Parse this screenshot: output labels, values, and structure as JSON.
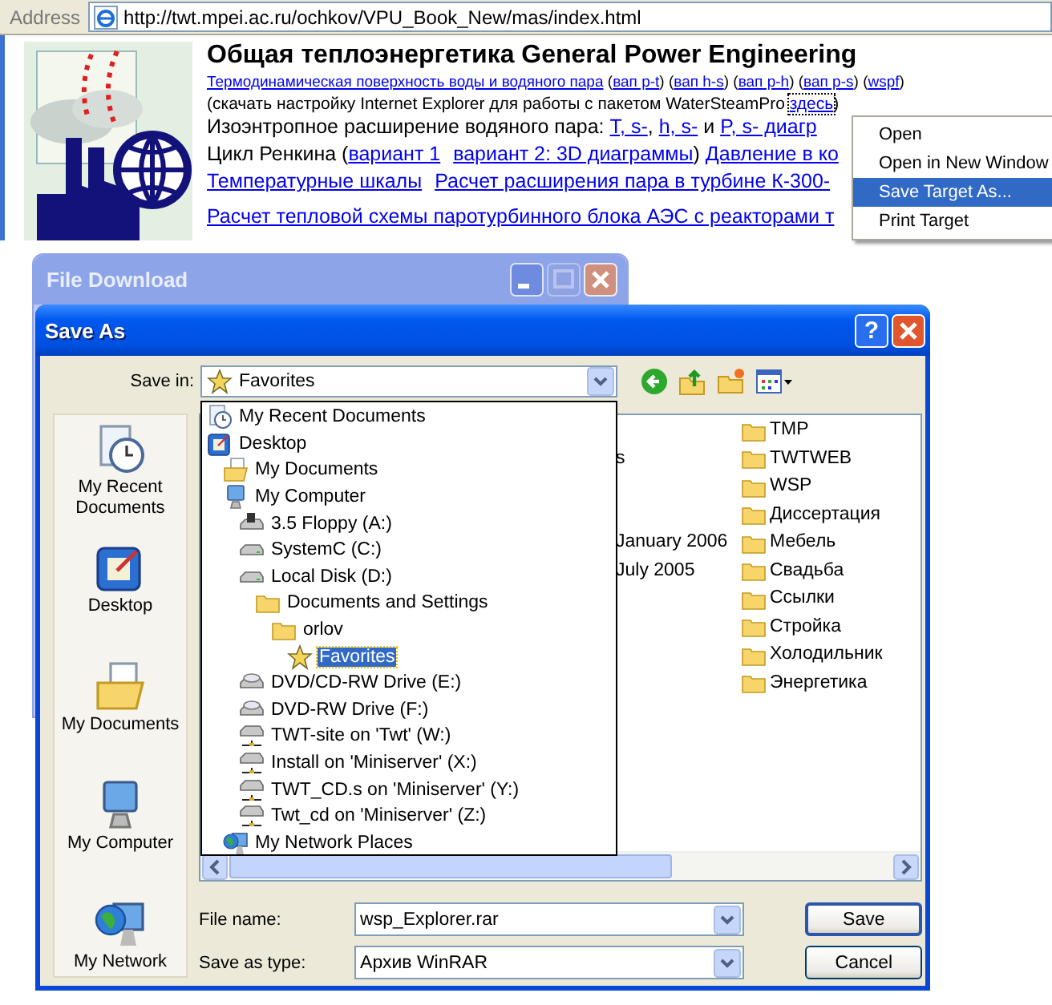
{
  "address_bar": {
    "label": "Address",
    "url": "http://twt.mpei.ac.ru/ochkov/VPU_Book_New/mas/index.html"
  },
  "page": {
    "title": "Общая теплоэнергетика General Power Engineering",
    "lines": [
      [
        {
          "text": "Термодинамическая поверхность воды и водяного пара",
          "kind": "link"
        },
        {
          "text": " (",
          "kind": "text"
        },
        {
          "text": "вап p-t",
          "kind": "link"
        },
        {
          "text": ") (",
          "kind": "text"
        },
        {
          "text": "вап h-s",
          "kind": "link"
        },
        {
          "text": ") (",
          "kind": "text"
        },
        {
          "text": "вап p-h",
          "kind": "link"
        },
        {
          "text": ") (",
          "kind": "text"
        },
        {
          "text": "вап p-s",
          "kind": "link"
        },
        {
          "text": ") (",
          "kind": "text"
        },
        {
          "text": "wspf",
          "kind": "link"
        },
        {
          "text": ")",
          "kind": "text"
        }
      ],
      [
        {
          "text": "(скачать настройку Internet Explorer для работы с пакетом WaterSteamPro ",
          "kind": "text"
        },
        {
          "text": "здесь",
          "kind": "link",
          "focused": true
        },
        {
          "text": ")",
          "kind": "text"
        }
      ],
      [
        {
          "text": "Изоэнтропное расширение водяного пара: ",
          "kind": "text"
        },
        {
          "text": "T, s-",
          "kind": "link"
        },
        {
          "text": ", ",
          "kind": "text"
        },
        {
          "text": "h, s-",
          "kind": "link"
        },
        {
          "text": " и ",
          "kind": "text"
        },
        {
          "text": "P, s- диагр",
          "kind": "link"
        }
      ],
      [
        {
          "text": "Цикл Ренкина (",
          "kind": "text"
        },
        {
          "text": "вариант 1",
          "kind": "link"
        },
        {
          "text": "вариант 2: 3D диаграммы",
          "kind": "link"
        },
        {
          "text": ") ",
          "kind": "text"
        },
        {
          "text": "Давление в ко",
          "kind": "link"
        }
      ],
      [
        {
          "text": "Температурные шкалы",
          "kind": "link"
        },
        {
          "text": "Расчет расширения пара в турбине К-300-",
          "kind": "link"
        }
      ],
      [
        {
          "text": "Расчет тепловой схемы паротурбинного блока АЭС с реакторами т",
          "kind": "link"
        }
      ]
    ]
  },
  "context_menu": {
    "items": [
      {
        "label": "Open",
        "selected": false
      },
      {
        "label": "Open in New Window",
        "selected": false
      },
      {
        "label": "Save Target As...",
        "selected": true
      },
      {
        "label": "Print Target",
        "selected": false
      }
    ]
  },
  "file_download": {
    "title": "File Download"
  },
  "save_as": {
    "title": "Save As",
    "help": "?",
    "save_in": {
      "label": "Save in:",
      "value": "Favorites",
      "kind": "favorites"
    },
    "places": [
      {
        "label": "My Recent Documents",
        "kind": "recent"
      },
      {
        "label": "Desktop",
        "kind": "desktop"
      },
      {
        "label": "My Documents",
        "kind": "documents"
      },
      {
        "label": "My Computer",
        "kind": "computer"
      },
      {
        "label": "My Network",
        "kind": "network"
      }
    ],
    "dropdown": [
      {
        "label": "My Recent Documents",
        "kind": "recent",
        "selected": false
      },
      {
        "label": "Desktop",
        "kind": "desktop",
        "selected": false,
        "children": [
          {
            "label": "My Documents",
            "kind": "documents",
            "selected": false
          },
          {
            "label": "My Computer",
            "kind": "computer",
            "selected": false,
            "children": [
              {
                "label": "3.5 Floppy (A:)",
                "kind": "floppy",
                "selected": false
              },
              {
                "label": "SystemC (C:)",
                "kind": "drive",
                "selected": false
              },
              {
                "label": "Local Disk (D:)",
                "kind": "drive",
                "selected": false,
                "children": [
                  {
                    "label": "Documents and Settings",
                    "kind": "folder",
                    "selected": false,
                    "children": [
                      {
                        "label": "orlov",
                        "kind": "folder",
                        "selected": false,
                        "children": [
                          {
                            "label": "Favorites",
                            "kind": "favorites",
                            "selected": true
                          }
                        ]
                      }
                    ]
                  }
                ]
              },
              {
                "label": "DVD/CD-RW Drive (E:)",
                "kind": "cd",
                "selected": false
              },
              {
                "label": "DVD-RW Drive (F:)",
                "kind": "cd",
                "selected": false
              },
              {
                "label": "TWT-site on 'Twt' (W:)",
                "kind": "netdrive",
                "selected": false
              },
              {
                "label": "Install on 'Miniserver' (X:)",
                "kind": "netdrive",
                "selected": false
              },
              {
                "label": "TWT_CD.s on 'Miniserver' (Y:)",
                "kind": "netdrive",
                "selected": false
              },
              {
                "label": "Twt_cd on 'Miniserver' (Z:)",
                "kind": "netdrive",
                "selected": false
              }
            ]
          },
          {
            "label": "My Network Places",
            "kind": "network",
            "selected": false
          }
        ]
      }
    ],
    "file_list": {
      "details": [
        "s",
        "January 2006",
        "July 2005"
      ],
      "folders": [
        "TMP",
        "TWTWEB",
        "WSP",
        "Диссертация",
        "Мебель",
        "Свадьба",
        "Ссылки",
        "Стройка",
        "Холодильник",
        "Энергетика"
      ]
    },
    "file_name": {
      "label": "File name:",
      "value": "wsp_Explorer.rar"
    },
    "save_type": {
      "label": "Save as type:",
      "value": "Архив WinRAR"
    },
    "buttons": [
      {
        "label": "Save",
        "default": true
      },
      {
        "label": "Cancel",
        "default": false
      }
    ]
  }
}
